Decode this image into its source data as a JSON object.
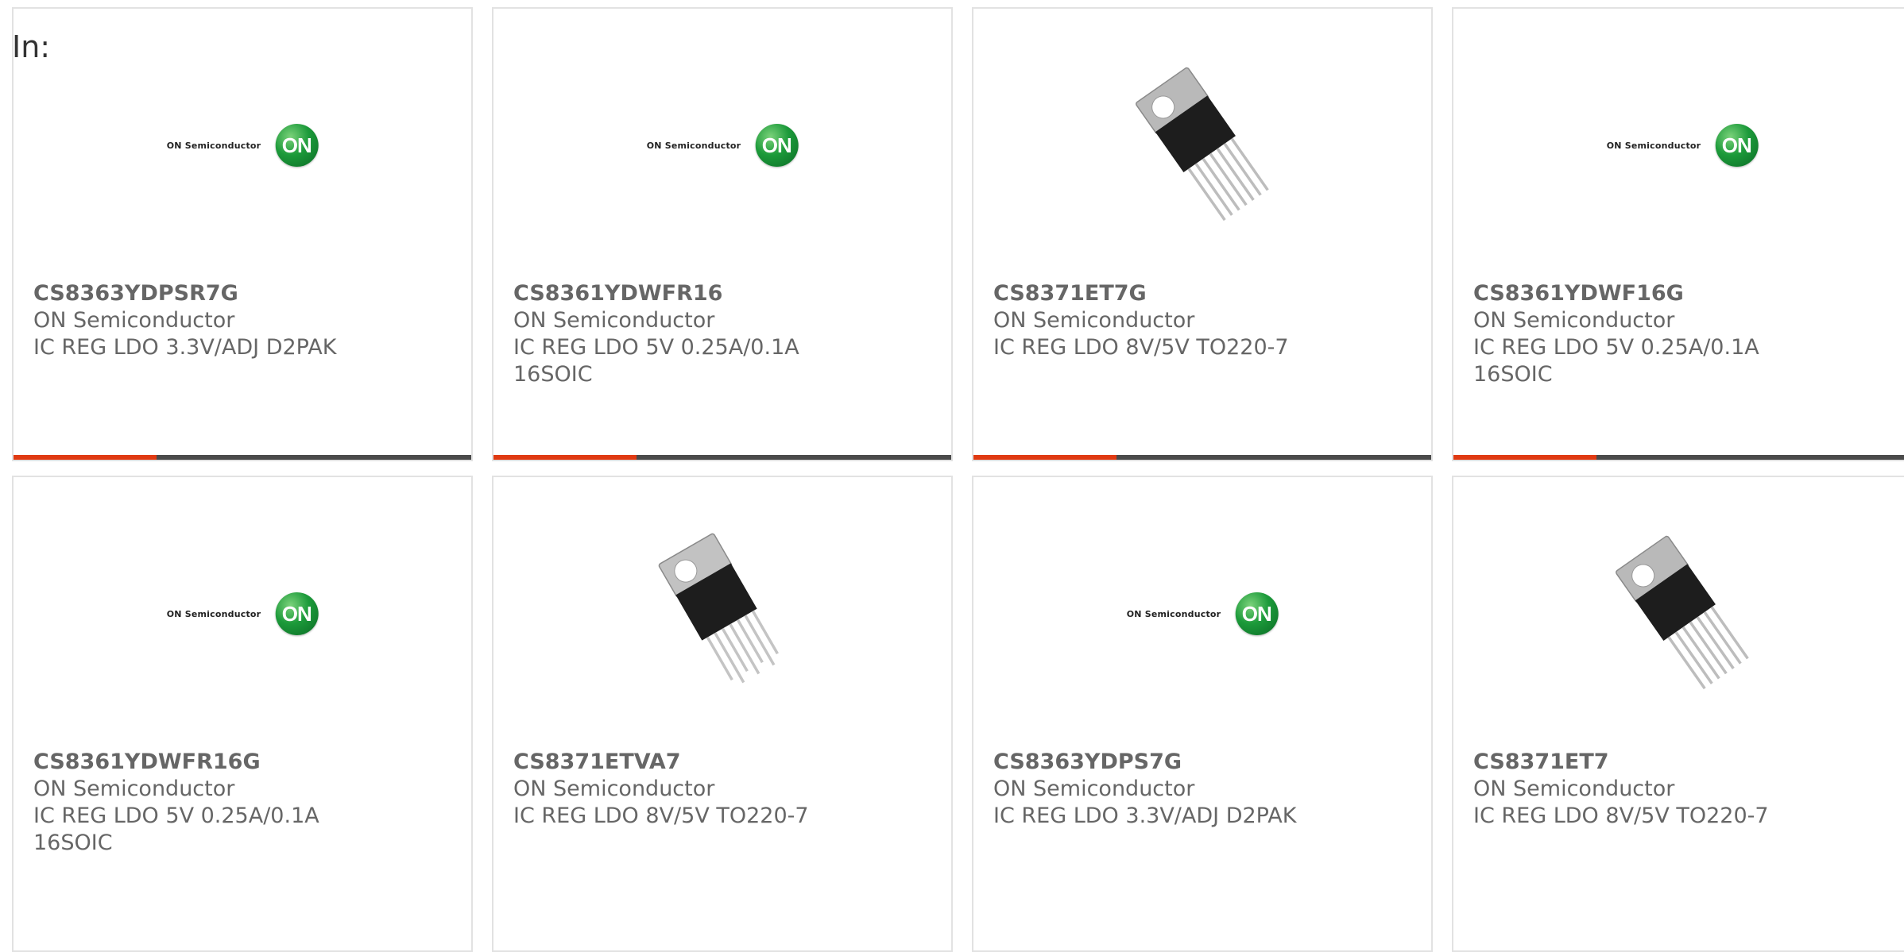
{
  "page_label": "In:",
  "colors": {
    "accent": "#e03a12",
    "bar": "#4a4a4a",
    "card_border": "#e2e2e2",
    "text": "#666666"
  },
  "products": [
    {
      "part_number": "CS8363YDPSR7G",
      "manufacturer": "ON Semiconductor",
      "description": "IC REG LDO 3.3V/ADJ D2PAK",
      "image": "on-semiconductor-logo",
      "logo_text": "ON Semiconductor",
      "logo_badge": "ON"
    },
    {
      "part_number": "CS8361YDWFR16",
      "manufacturer": "ON Semiconductor",
      "description": "IC REG LDO 5V 0.25A/0.1A 16SOIC",
      "image": "on-semiconductor-logo",
      "logo_text": "ON Semiconductor",
      "logo_badge": "ON"
    },
    {
      "part_number": "CS8371ET7G",
      "manufacturer": "ON Semiconductor",
      "description": "IC REG LDO 8V/5V TO220-7",
      "image": "to220-package-photo"
    },
    {
      "part_number": "CS8361YDWF16G",
      "manufacturer": "ON Semiconductor",
      "description": "IC REG LDO 5V 0.25A/0.1A 16SOIC",
      "image": "on-semiconductor-logo",
      "logo_text": "ON Semiconductor",
      "logo_badge": "ON"
    },
    {
      "part_number": "CS8361YDWFR16G",
      "manufacturer": "ON Semiconductor",
      "description": "IC REG LDO 5V 0.25A/0.1A 16SOIC",
      "image": "on-semiconductor-logo",
      "logo_text": "ON Semiconductor",
      "logo_badge": "ON"
    },
    {
      "part_number": "CS8371ETVA7",
      "manufacturer": "ON Semiconductor",
      "description": "IC REG LDO 8V/5V TO220-7",
      "image": "to220-package-photo"
    },
    {
      "part_number": "CS8363YDPS7G",
      "manufacturer": "ON Semiconductor",
      "description": "IC REG LDO 3.3V/ADJ D2PAK",
      "image": "on-semiconductor-logo",
      "logo_text": "ON Semiconductor",
      "logo_badge": "ON"
    },
    {
      "part_number": "CS8371ET7",
      "manufacturer": "ON Semiconductor",
      "description": "IC REG LDO 8V/5V TO220-7",
      "image": "to220-package-photo"
    }
  ]
}
